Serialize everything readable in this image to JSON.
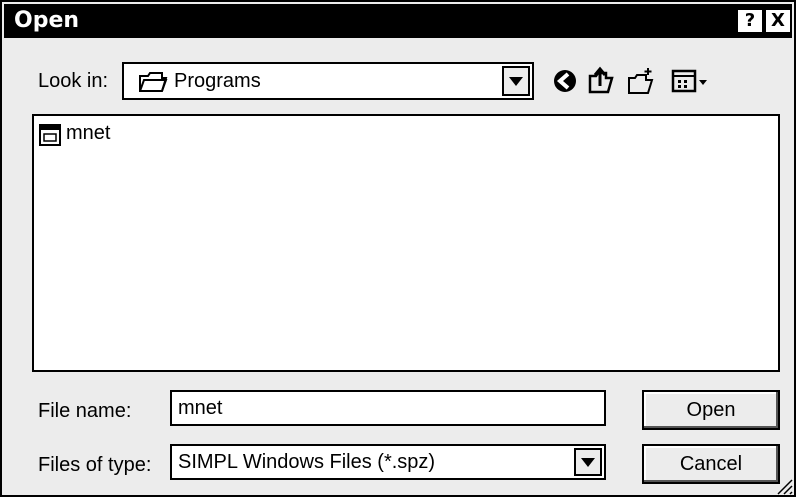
{
  "window": {
    "title": "Open",
    "help_label": "?",
    "close_label": "X"
  },
  "lookin": {
    "label": "Look in:",
    "value": "Programs"
  },
  "toolbar": [
    "back-icon",
    "up-folder-icon",
    "new-folder-icon",
    "view-menu-icon"
  ],
  "files": [
    {
      "name": "mnet",
      "icon": "executable-file-icon"
    }
  ],
  "filename": {
    "label": "File name:",
    "value": "mnet"
  },
  "filetype": {
    "label": "Files of type:",
    "value": "SIMPL Windows Files (*.spz)"
  },
  "buttons": {
    "open": "Open",
    "cancel": "Cancel"
  }
}
